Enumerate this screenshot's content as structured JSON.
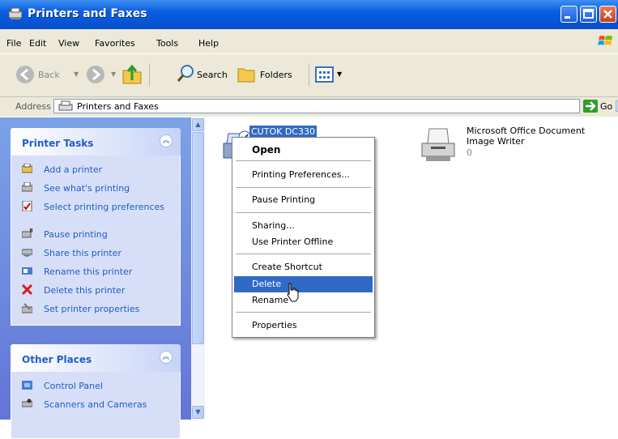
{
  "window": {
    "title": "Printers and Faxes"
  },
  "menubar": {
    "items": [
      "File",
      "Edit",
      "View",
      "Favorites",
      "Tools",
      "Help"
    ]
  },
  "toolbar": {
    "back": "Back",
    "search": "Search",
    "folders": "Folders"
  },
  "address": {
    "label": "Address",
    "value": "Printers and Faxes",
    "go": "Go"
  },
  "tasks": {
    "title": "Printer Tasks",
    "items": [
      "Add a printer",
      "See what's printing",
      "Select printing preferences",
      "Pause printing",
      "Share this printer",
      "Rename this printer",
      "Delete this printer",
      "Set printer properties"
    ]
  },
  "places": {
    "title": "Other Places",
    "items": [
      "Control Panel",
      "Scanners and Cameras"
    ]
  },
  "printers": [
    {
      "name": "CUTOK DC330",
      "selected": true
    },
    {
      "name": "Microsoft Office Document Image Writer",
      "count": "0"
    }
  ],
  "context_menu": {
    "items": [
      "Open",
      "Printing Preferences...",
      "Pause Printing",
      "Sharing...",
      "Use Printer Offline",
      "Create Shortcut",
      "Delete",
      "Rename",
      "Properties"
    ],
    "highlighted": "Delete"
  },
  "colors": {
    "titlebar": "#0a5ee0",
    "selection": "#316ac5",
    "task_link": "#215dc6",
    "pane": "#7ba2e7"
  }
}
